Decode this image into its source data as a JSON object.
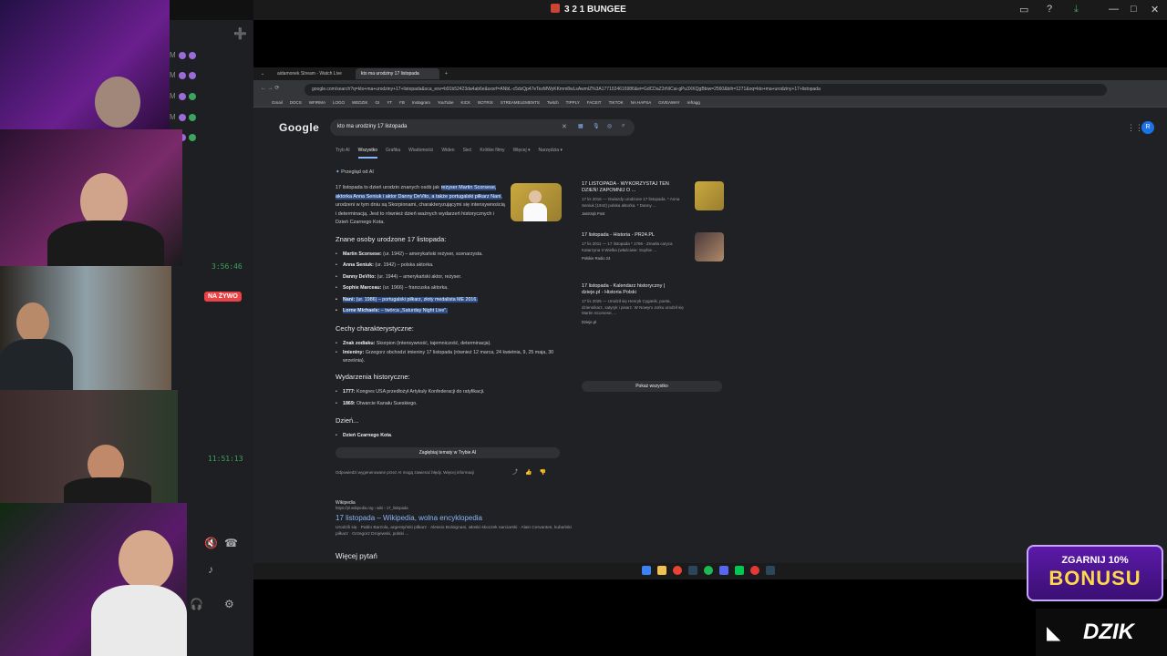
{
  "window": {
    "title": "3 2 1 BUNGEE"
  },
  "stream": {
    "timer1": "3:56:46",
    "timer2": "11:51:13",
    "live_label": "NA ŻYWO"
  },
  "browser": {
    "tabs": [
      {
        "label": "aidamonek Stream - Watch Live"
      },
      {
        "label": "kto ma urodziny 17 listopada"
      }
    ],
    "url": "google.com/search?q=kto+ma+urodziny+17+listopada&sca_esv=b91b52423da4ab6e&sxsrf=ANbL-c5dzQp47eTezMWyKKmm8wLsAwmlZ%3A1771024616986&ei=GdCDaZ2rNICai-gPu3XKQgBbiw=2560&bih=1271&oq=kto+ma+urodziny+17+listopada",
    "bookmarks": [
      "Gmail",
      "DOCS",
      "WFIRMA",
      "LOGO",
      "WEDZIK",
      "GI",
      "YT",
      "FB",
      "Instagram",
      "YouTube",
      "KICK",
      "BOTRIX",
      "STREAMELEMENTS",
      "Twitch",
      "TIPPLY",
      "FACEIT",
      "TIKTOK",
      "NA HAPSA",
      "GIVEAWAY",
      "refragg"
    ]
  },
  "google": {
    "logo": "Google",
    "query": "kto ma urodziny 17 listopada",
    "tabs": [
      "Tryb AI",
      "Wszystko",
      "Grafika",
      "Wiadomości",
      "Wideo",
      "Sieć",
      "Krótkie filmy",
      "Więcej ▾",
      "Narzędzia ▾"
    ],
    "ai_header": "Przegląd od AI",
    "ai_intro_pre": "17 listopada to dzień urodzin znanych osób jak ",
    "ai_intro_hl": "reżyser Martin Scorsese, aktorka Anna Seniuk i aktor Danny DeVito, a także portugalski piłkarz Nani",
    "ai_intro_post": ", urodzeni w tym dniu są Skorpionami, charakteryzującymi się intensywnością i determinacją. Jest to również dzień ważnych wydarzeń historycznych i Dzień Czarnego Kota.",
    "sec1": "Znane osoby urodzone 17 listopada:",
    "people": [
      {
        "name": "Martin Scorsese:",
        "desc": " (ur. 1942) – amerykański reżyser, scenarzysta."
      },
      {
        "name": "Anna Seniuk:",
        "desc": " (ur. 1942) – polska aktorka."
      },
      {
        "name": "Danny DeVito:",
        "desc": " (ur. 1944) – amerykański aktor, reżyser."
      },
      {
        "name": "Sophie Marceau:",
        "desc": " (ur. 1966) – francuska aktorka."
      },
      {
        "name": "Nani:",
        "desc": " (ur. 1986) – portugalski piłkarz, złoty medalista ME 2016."
      },
      {
        "name": "Lorne Michaels:",
        "desc": " – twórca „Saturday Night Live\"."
      }
    ],
    "sec2": "Cechy charakterystyczne:",
    "traits": [
      {
        "name": "Znak zodiaku:",
        "desc": " Skorpion (intensywność, tajemniczość, determinacja)."
      },
      {
        "name": "Imieniny:",
        "desc": " Grzegorz obchodzi imieniny 17 listopada (również 12 marca, 24 kwietnia, 9, 25 maja, 30 września)."
      }
    ],
    "sec3": "Wydarzenia historyczne:",
    "events": [
      {
        "name": "1777:",
        "desc": " Kongres USA przedłożył Artykuły Konfederacji do ratyfikacji."
      },
      {
        "name": "1869:",
        "desc": " Otwarcie Kanału Sueskiego."
      }
    ],
    "sec4": "Dzień...",
    "days": [
      {
        "name": "Dzień Czarnego Kota",
        "desc": "."
      }
    ],
    "deeper": "Zagłębiaj tematy w Trybie AI",
    "disclaimer": "Odpowiedzi wygenerowane przez AI mogą zawierać błędy. Więcej informacji",
    "sources": [
      {
        "title": "17 LISTOPADA - WYKORZYSTAJ TEN DZIEŃ! ZAPOMNIJ O ...",
        "snippet": "17 lis 2016 — Gwiazdy urodzone 17 listopada. * Anna Seniuk (1942) polska aktorka. * Danny ...",
        "site": "Jastrząb Post",
        "color": "#c7a43c"
      },
      {
        "title": "17 listopada - Historia - PR24.PL",
        "snippet": "17 lis 2011 — 17 listopada * 1796 - Zmarła caryca Katarzyna II Wielka (właściwie: Sophie ...",
        "site": "Polskie Radio 24",
        "color": "#6b4a3a"
      },
      {
        "title": "17 listopada - Kalendarz historyczny | dzieje.pl - Historia Polski",
        "snippet": "17 lis 2025 — Urodził się Henryk Cyganik, poeta, dziennikarz, satyryk i pisarz. W Nowym Jorku urodził się Martin Scorsese, ...",
        "site": "Dzieje.pl",
        "color": ""
      }
    ],
    "show_all": "Pokaż wszystko",
    "wiki": {
      "site": "Wikipedia",
      "url": "https://pl.wikipedia.org › wiki › 17_listopada",
      "title": "17 listopada – Wikipedia, wolna encyklopedia",
      "snippet": "Urodzili się · Pablo Barzola, argentyński piłkarz · Alessio Boloignani, włoski skoczek narciarski · Alain Cervantes, kubański piłkarz · Grzegorz Drojewski, polski ..."
    },
    "more": "Więcej pytań"
  },
  "overlay": {
    "bonus_line1": "ZGARNIJ 10%",
    "bonus_line2": "BONUSU",
    "brand": "DZIK"
  },
  "icons": [
    "search-icon",
    "mic-icon",
    "camera-icon",
    "close-icon",
    "apps-grid-icon",
    "thumb-up-icon",
    "thumb-down-icon",
    "share-icon",
    "add-friend-icon",
    "phone-icon",
    "headphones-icon",
    "gear-icon"
  ]
}
